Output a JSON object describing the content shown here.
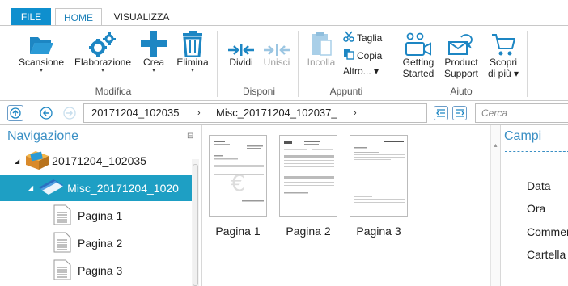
{
  "tabs": {
    "file": "FILE",
    "home": "HOME",
    "view": "VISUALIZZA"
  },
  "ribbon": {
    "scansione": "Scansione",
    "elaborazione": "Elaborazione",
    "crea": "Crea",
    "elimina": "Elimina",
    "modifica_group": "Modifica",
    "dividi": "Dividi",
    "unisci": "Unisci",
    "disponi_group": "Disponi",
    "incolla": "Incolla",
    "taglia": "Taglia",
    "copia": "Copia",
    "altro": "Altro... ▾",
    "appunti_group": "Appunti",
    "getting_started_1": "Getting",
    "getting_started_2": "Started",
    "product_support_1": "Product",
    "product_support_2": "Support",
    "scopri_1": "Scopri",
    "scopri_2": "di più ▾",
    "aiuto_group": "Aiuto",
    "dropdown_marker": "▾"
  },
  "navbar": {
    "crumb1": "20171204_102035",
    "crumb2": "Misc_20171204_102037_",
    "crumb_sep": "›",
    "search_placeholder": "Cerca"
  },
  "sidebar": {
    "title": "Navigazione",
    "tree": [
      {
        "label": "20171204_102035"
      },
      {
        "label": "Misc_20171204_1020"
      },
      {
        "label": "Pagina 1"
      },
      {
        "label": "Pagina 2"
      },
      {
        "label": "Pagina 3"
      }
    ]
  },
  "content": {
    "pages": [
      {
        "label": "Pagina 1"
      },
      {
        "label": "Pagina 2"
      },
      {
        "label": "Pagina 3"
      }
    ]
  },
  "properties": {
    "title": "Campi",
    "fields": [
      "Data",
      "Ora",
      "Commento",
      "Cartella"
    ]
  },
  "colors": {
    "accent": "#0f8fce",
    "selection": "#1e9fc4",
    "icon_blue": "#1d86c3"
  }
}
